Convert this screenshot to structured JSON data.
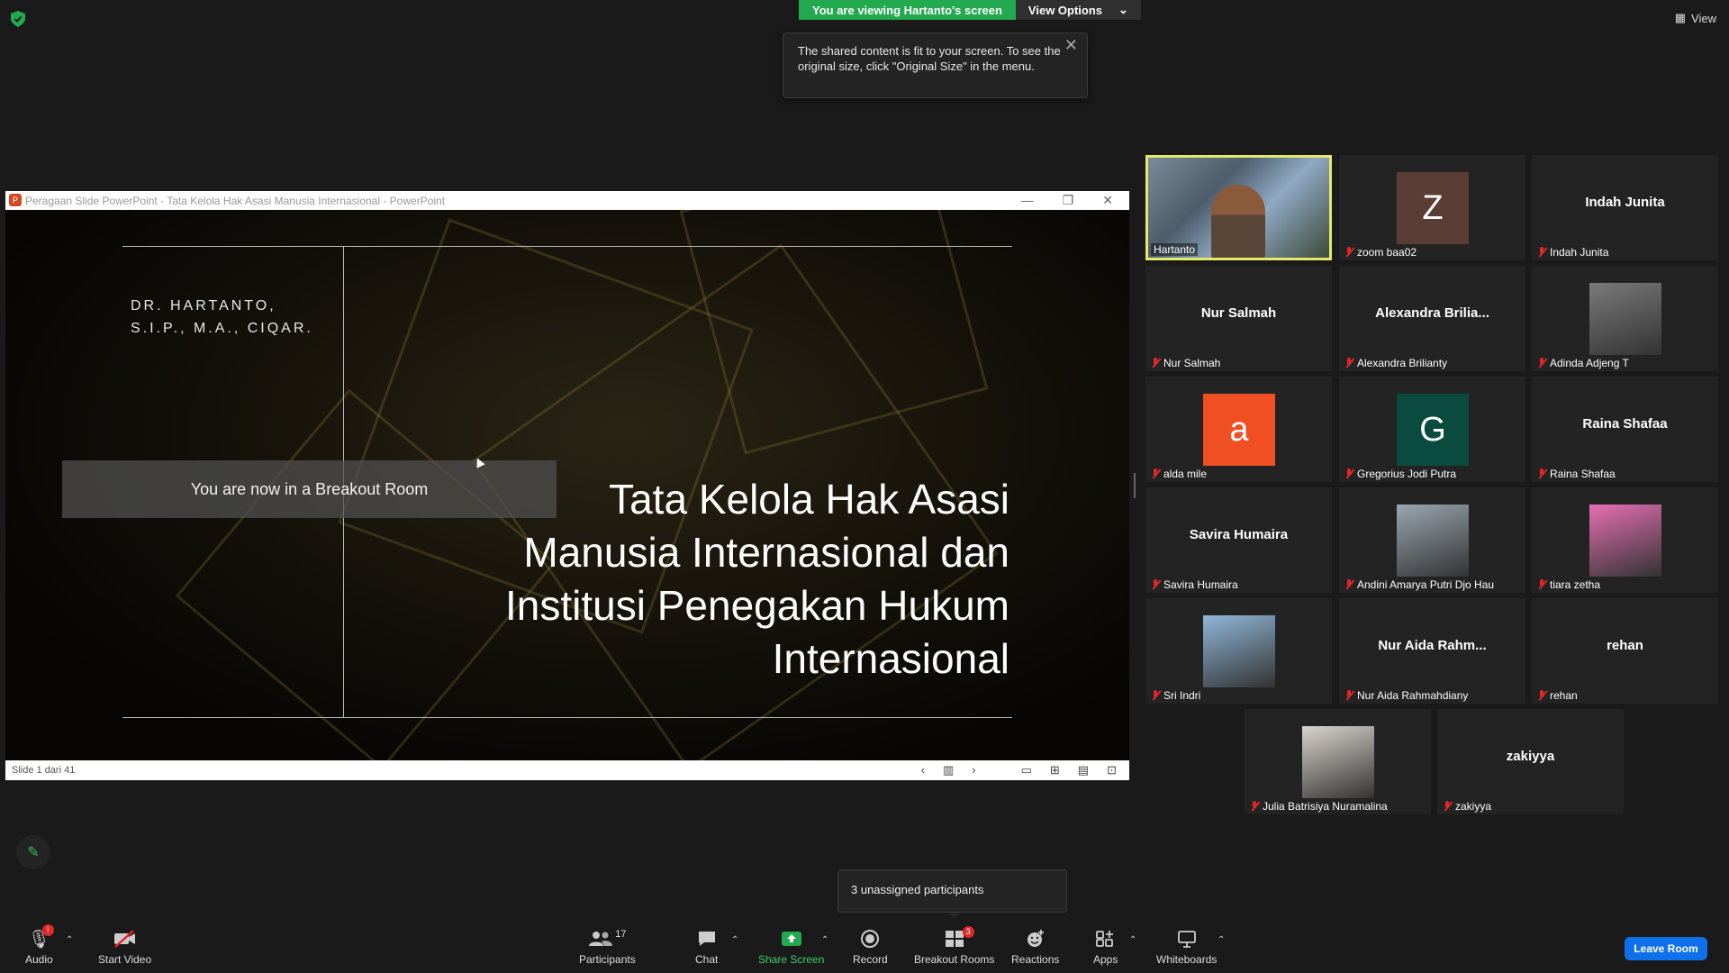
{
  "banner": {
    "viewing": "You are viewing Hartanto's screen",
    "view_options": "View Options"
  },
  "tooltip": {
    "text": "The shared content is fit to your screen. To see the original size, click \"Original Size\" in the menu."
  },
  "view_button": "View",
  "ppt": {
    "title": "Peragaan Slide PowerPoint  -  Tata Kelola Hak Asasi Manusia Internasional  -  PowerPoint",
    "slide_author_line1": "DR. HARTANTO,",
    "slide_author_line2": "S.I.P., M.A., CIQAR.",
    "slide_title": "Tata Kelola Hak Asasi Manusia Internasional dan Institusi Penegakan Hukum Internasional",
    "status": "Slide 1 dari 41"
  },
  "breakout_notice": "You are now in a Breakout Room",
  "participants": [
    {
      "name": "Hartanto",
      "type": "video",
      "active": true
    },
    {
      "name": "zoom baa02",
      "type": "avatar",
      "initial": "Z",
      "color": "#5a3d35"
    },
    {
      "name": "Indah Junita",
      "type": "text",
      "display": "Indah Junita"
    },
    {
      "name": "Nur Salmah",
      "type": "text",
      "display": "Nur Salmah"
    },
    {
      "name": "Alexandra Brilianty",
      "type": "text",
      "display": "Alexandra  Brilia..."
    },
    {
      "name": "Adinda Adjeng T",
      "type": "photo",
      "color": "#7a7a7a"
    },
    {
      "name": "alda mile",
      "type": "avatar",
      "initial": "a",
      "color": "#f04e23"
    },
    {
      "name": "Gregorius Jodi Putra",
      "type": "avatar",
      "initial": "G",
      "color": "#0b4a3f"
    },
    {
      "name": "Raina Shafaa",
      "type": "text",
      "display": "Raina Shafaa"
    },
    {
      "name": "Savira Humaira",
      "type": "text",
      "display": "Savira Humaira"
    },
    {
      "name": "Andini Amarya Putri Djo Hau",
      "type": "photo",
      "color": "#9aa6b0"
    },
    {
      "name": "tiara zetha",
      "type": "photo",
      "color": "#e56fb3"
    },
    {
      "name": "Sri Indri",
      "type": "photo",
      "color": "#8fb6d8"
    },
    {
      "name": "Nur Aida Rahmahdiany",
      "type": "text",
      "display": "Nur Aida Rahm..."
    },
    {
      "name": "rehan",
      "type": "text",
      "display": "rehan"
    },
    {
      "name": "Julia Batrisiya Nuramalina",
      "type": "photo",
      "color": "#d9d4cc"
    },
    {
      "name": "zakiyya",
      "type": "text",
      "display": "zakiyya"
    }
  ],
  "unassigned": "3 unassigned participants",
  "toolbar": {
    "audio": "Audio",
    "audio_badge": "!",
    "video": "Start Video",
    "participants": "Participants",
    "participants_count": "17",
    "chat": "Chat",
    "share": "Share Screen",
    "record": "Record",
    "breakout": "Breakout Rooms",
    "breakout_badge": "3",
    "reactions": "Reactions",
    "apps": "Apps",
    "whiteboards": "Whiteboards",
    "leave": "Leave Room"
  },
  "colors": {
    "accent_green": "#23a94f",
    "leave_blue": "#0e71eb",
    "mute_red": "#e02828",
    "active_border": "#e5e86a"
  }
}
